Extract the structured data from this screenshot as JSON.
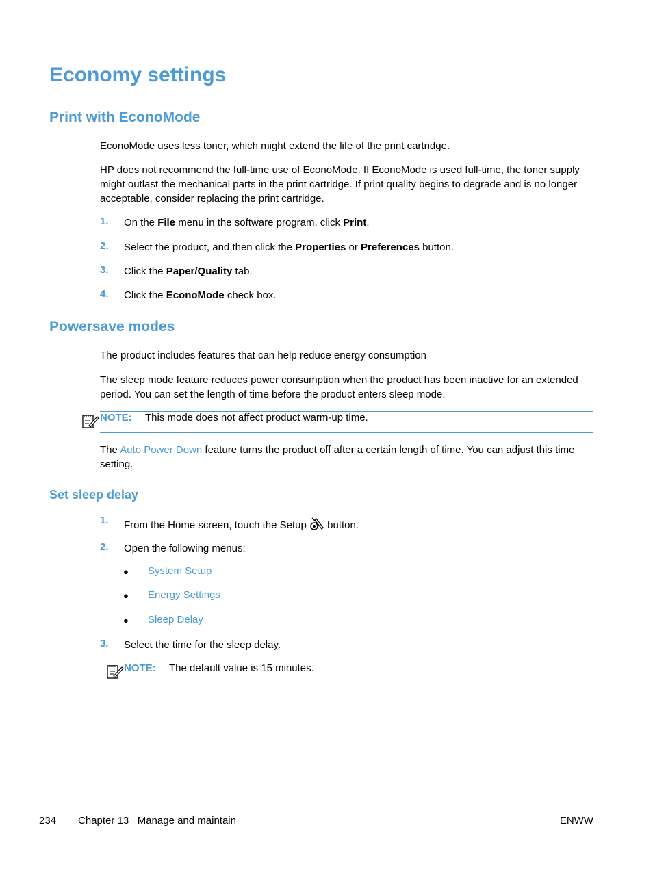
{
  "title": "Economy settings",
  "section1": {
    "heading": "Print with EconoMode",
    "para1": "EconoMode uses less toner, which might extend the life of the print cartridge.",
    "para2": "HP does not recommend the full-time use of EconoMode. If EconoMode is used full-time, the toner supply might outlast the mechanical parts in the print cartridge. If print quality begins to degrade and is no longer acceptable, consider replacing the print cartridge.",
    "steps": [
      {
        "num": "1.",
        "pre": "On the ",
        "b1": "File",
        "mid": " menu in the software program, click ",
        "b2": "Print",
        "post": "."
      },
      {
        "num": "2.",
        "pre": "Select the product, and then click the ",
        "b1": "Properties",
        "mid": " or ",
        "b2": "Preferences",
        "post": " button."
      },
      {
        "num": "3.",
        "pre": "Click the ",
        "b1": "Paper/Quality",
        "post": " tab."
      },
      {
        "num": "4.",
        "pre": "Click the ",
        "b1": "EconoMode",
        "post": " check box."
      }
    ]
  },
  "section2": {
    "heading": "Powersave modes",
    "para1": "The product includes features that can help reduce energy consumption",
    "para2": "The sleep mode feature reduces power consumption when the product has been inactive for an extended period. You can set the length of time before the product enters sleep mode.",
    "note": {
      "label": "NOTE:",
      "text": "This mode does not affect product warm-up time."
    },
    "para3": {
      "pre": "The ",
      "link": "Auto Power Down",
      "post": " feature turns the product off after a certain length of time. You can adjust this time setting."
    }
  },
  "section3": {
    "heading": "Set sleep delay",
    "step1": {
      "num": "1.",
      "pre": "From the Home screen, touch the Setup ",
      "post": " button."
    },
    "step2": {
      "num": "2.",
      "text": "Open the following menus:"
    },
    "menus": [
      "System Setup",
      "Energy Settings",
      "Sleep Delay"
    ],
    "bullet": "●",
    "step3": {
      "num": "3.",
      "text": "Select the time for the sleep delay."
    },
    "note": {
      "label": "NOTE:",
      "text": "The default value is 15 minutes."
    }
  },
  "footer": {
    "page": "234",
    "chapter": "Chapter 13   Manage and maintain",
    "right": "ENWW"
  }
}
